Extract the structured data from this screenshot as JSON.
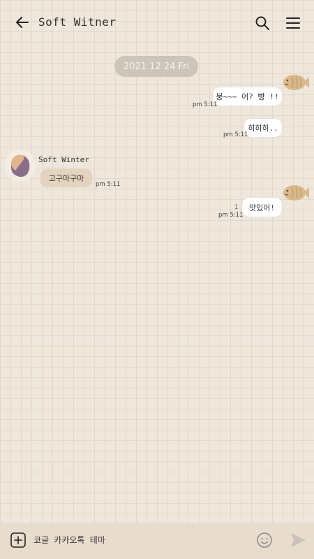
{
  "header": {
    "title": "Soft Witner"
  },
  "chat": {
    "date_divider": "2021 12 24 Fri",
    "sender_name": "Soft Winter",
    "messages": [
      {
        "direction": "sent",
        "text": "붕~~~ 어? 빵 !!",
        "time": "pm 5:11"
      },
      {
        "direction": "sent",
        "text": "히히히..",
        "time": "pm 5:11"
      },
      {
        "direction": "received",
        "text": "고구마구마",
        "time": "pm 5:11"
      },
      {
        "direction": "sent",
        "text": "맛있어!",
        "time": "pm 5:11",
        "unread_count": "1"
      }
    ]
  },
  "input": {
    "placeholder": "코글 카카오톡 테마"
  },
  "colors": {
    "background": "#efe7dc",
    "grid": "#e2d8cb",
    "sent_bubble": "#ffffff",
    "received_bubble": "#e4d4bf",
    "date_pill": "#cdc4ba",
    "input_bar": "#e8dccd"
  },
  "icons": {
    "back": "arrow-left-icon",
    "search": "search-icon",
    "menu": "hamburger-menu-icon",
    "sticker": "bungeoppang-fish-icon",
    "avatar": "sweet-potato-avatar",
    "plus": "plus-square-icon",
    "emoji": "smiley-icon",
    "send": "send-icon"
  }
}
